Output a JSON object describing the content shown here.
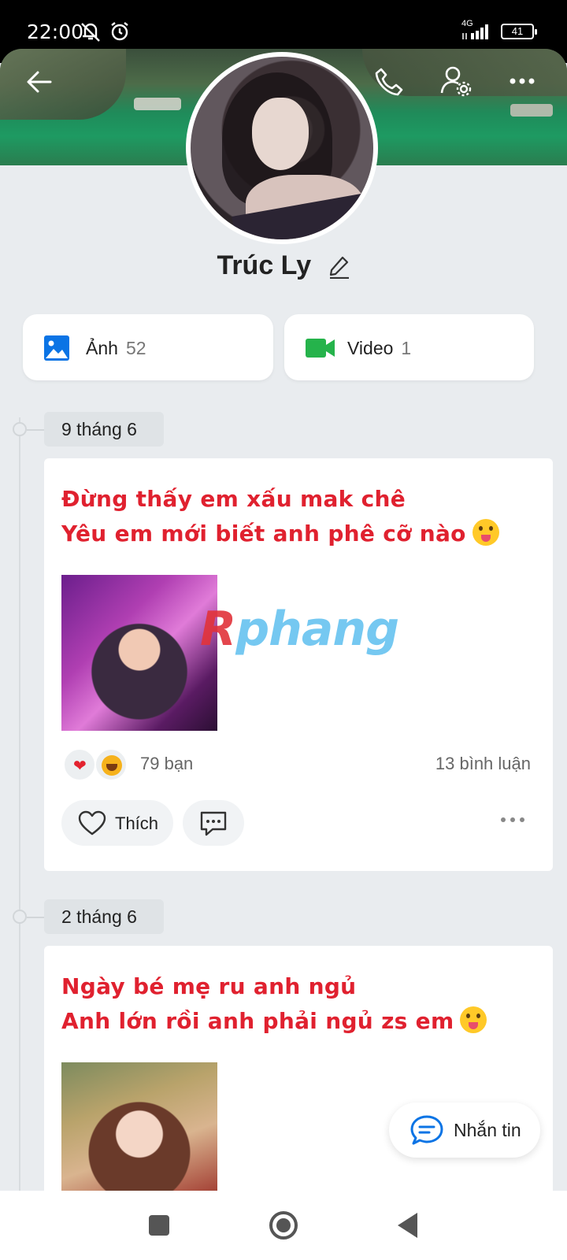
{
  "status_bar": {
    "time": "22:00",
    "network": "4G",
    "battery": "41"
  },
  "profile": {
    "name": "Trúc Ly"
  },
  "media": [
    {
      "label": "Ảnh",
      "count": "52"
    },
    {
      "label": "Video",
      "count": "1"
    }
  ],
  "posts": [
    {
      "date": "9 tháng 6",
      "line1": "Đừng thấy em xấu mak chê",
      "line2": "Yêu em mới biết anh phê cỡ nào",
      "reactions": "79 bạn",
      "comments": "13 bình luận",
      "like_label": "Thích"
    },
    {
      "date": "2 tháng 6",
      "line1": "Ngày bé mẹ ru anh ngủ",
      "line2": "Anh lớn rồi anh phải ngủ zs em"
    }
  ],
  "fab": {
    "label": "Nhắn tin"
  },
  "watermark": {
    "part1": "R",
    "part2": "phang"
  },
  "icons": {
    "back": "arrow-left-icon",
    "call": "phone-icon",
    "settings": "user-settings-icon",
    "more": "more-horizontal-icon",
    "photo": "image-icon",
    "video": "video-camera-icon",
    "like": "heart-outline-icon",
    "comment": "comment-icon",
    "message": "message-bubble-icon"
  },
  "colors": {
    "accent": "#0b74e5",
    "post_text": "#e0212f",
    "video_green": "#25b34b"
  }
}
